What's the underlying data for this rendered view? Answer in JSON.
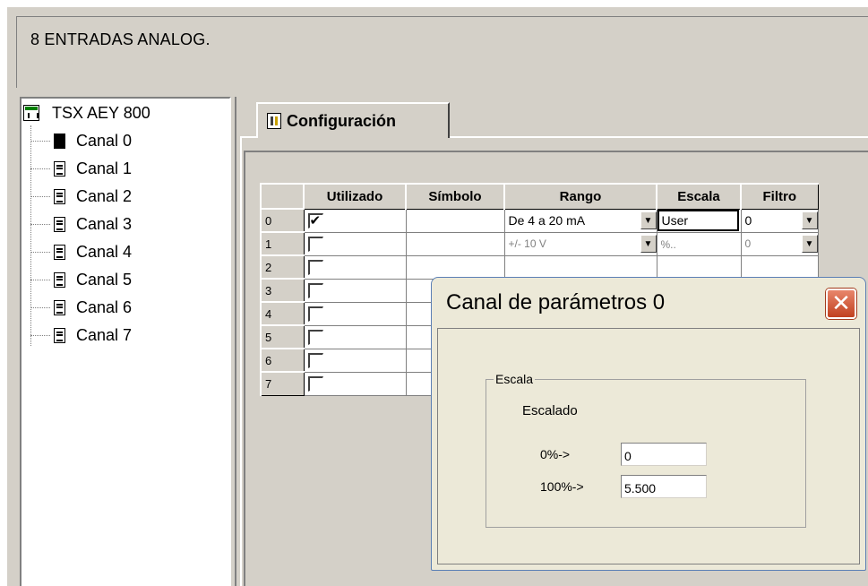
{
  "header": {
    "title": "8 ENTRADAS ANALOG."
  },
  "tree": {
    "root_label": "TSX AEY 800",
    "items": [
      {
        "label": "Canal 0"
      },
      {
        "label": "Canal 1"
      },
      {
        "label": "Canal 2"
      },
      {
        "label": "Canal 3"
      },
      {
        "label": "Canal 4"
      },
      {
        "label": "Canal 5"
      },
      {
        "label": "Canal 6"
      },
      {
        "label": "Canal 7"
      }
    ]
  },
  "tab": {
    "label": "Configuración"
  },
  "grid": {
    "headers": {
      "num": "",
      "utilizado": "Utilizado",
      "simbolo": "Símbolo",
      "rango": "Rango",
      "escala": "Escala",
      "filtro": "Filtro"
    },
    "rows": [
      {
        "num": "0",
        "checked": true,
        "simbolo": "",
        "rango": "De 4 a 20 mA",
        "escala": "User",
        "filtro": "0"
      },
      {
        "num": "1",
        "checked": false,
        "simbolo": "",
        "rango": "+/- 10 V",
        "escala": "%..",
        "filtro": "0"
      },
      {
        "num": "2",
        "checked": false,
        "simbolo": "",
        "rango": "",
        "escala": "",
        "filtro": ""
      },
      {
        "num": "3",
        "checked": false,
        "simbolo": "",
        "rango": "",
        "escala": "",
        "filtro": ""
      },
      {
        "num": "4",
        "checked": false,
        "simbolo": "",
        "rango": "",
        "escala": "",
        "filtro": ""
      },
      {
        "num": "5",
        "checked": false,
        "simbolo": "",
        "rango": "",
        "escala": "",
        "filtro": ""
      },
      {
        "num": "6",
        "checked": false,
        "simbolo": "",
        "rango": "",
        "escala": "",
        "filtro": ""
      },
      {
        "num": "7",
        "checked": false,
        "simbolo": "",
        "rango": "",
        "escala": "",
        "filtro": ""
      }
    ]
  },
  "dialog": {
    "title": "Canal de parámetros 0",
    "close_icon": "close-icon",
    "group_label": "Escala",
    "escalado_label": "Escalado",
    "fields": [
      {
        "label": "0%->",
        "value": "0"
      },
      {
        "label": "100%->",
        "value": "5.500"
      }
    ]
  },
  "colors": {
    "panel": "#d4d0c8",
    "dialog_bg": "#ece9d8",
    "close_button": "#c14120"
  }
}
